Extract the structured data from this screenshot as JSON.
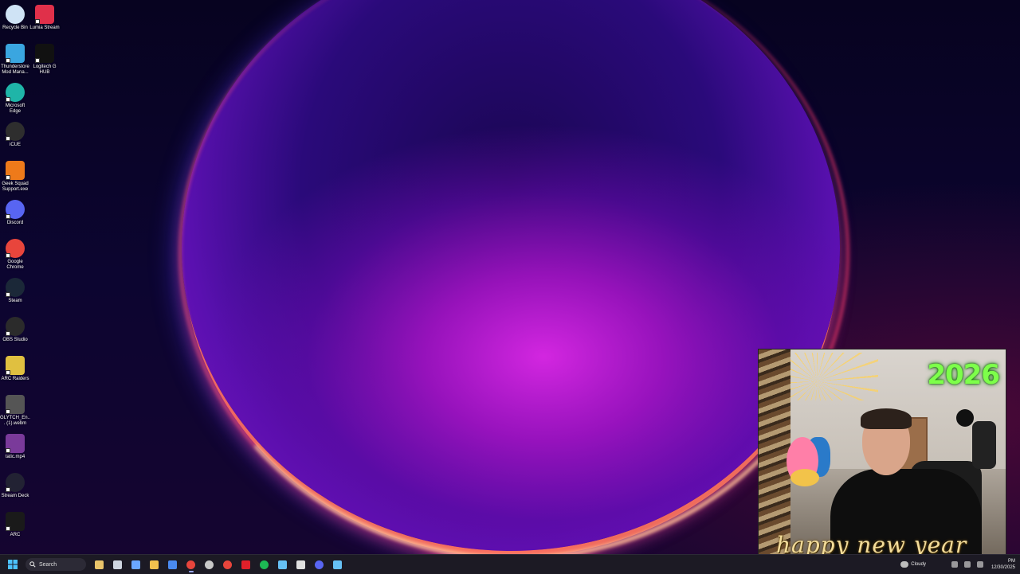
{
  "desktop": {
    "icons": [
      {
        "label": "Recycle Bin",
        "icon": "recycle-bin-icon",
        "color": "#cfe3f5"
      },
      {
        "label": "Lumia Stream",
        "icon": "lumia-stream-icon",
        "color": "#e0304a"
      },
      {
        "label": "Thunderstore Mod Mana...",
        "icon": "thunderstore-icon",
        "color": "#3aa6e0"
      },
      {
        "label": "Logitech G HUB",
        "icon": "logitech-g-icon",
        "color": "#111111"
      },
      {
        "label": "Microsoft Edge",
        "icon": "edge-icon",
        "color": "#1fb5a8"
      },
      {
        "label": "iCUE",
        "icon": "icue-icon",
        "color": "#2e2e2e"
      },
      {
        "label": "Geek Squad Support.exe",
        "icon": "geek-squad-icon",
        "color": "#ee7a1a"
      },
      {
        "label": "Discord",
        "icon": "discord-icon",
        "color": "#5865f2"
      },
      {
        "label": "Google Chrome",
        "icon": "chrome-icon",
        "color": "#e8453c"
      },
      {
        "label": "Steam",
        "icon": "steam-icon",
        "color": "#1b2838"
      },
      {
        "label": "OBS Studio",
        "icon": "obs-icon",
        "color": "#2b2b2b"
      },
      {
        "label": "ARC Raiders",
        "icon": "arc-raiders-icon",
        "color": "#e0c040"
      },
      {
        "label": "GLYTCH_En... (1).webm",
        "icon": "video-file-icon",
        "color": "#555555"
      },
      {
        "label": "tatic.mp4",
        "icon": "video-file-icon",
        "color": "#7a3a9a"
      },
      {
        "label": "Stream Deck",
        "icon": "stream-deck-icon",
        "color": "#222233"
      },
      {
        "label": "ARC",
        "icon": "arc-icon",
        "color": "#1a1a1a"
      }
    ]
  },
  "webcam": {
    "year_text": "2026",
    "overlay_text": "happy new year"
  },
  "taskbar": {
    "search_label": "Search",
    "apps": [
      {
        "icon": "file-explorer-widget-icon",
        "color": "#e9c46a"
      },
      {
        "icon": "task-view-icon",
        "color": "#cfd6e0"
      },
      {
        "icon": "copilot-icon",
        "color": "#6aa6ff"
      },
      {
        "icon": "file-explorer-icon",
        "color": "#f2c14e"
      },
      {
        "icon": "store-icon",
        "color": "#4a8af0"
      },
      {
        "icon": "chrome-icon",
        "color": "#e8453c",
        "active": true
      },
      {
        "icon": "obs-icon",
        "color": "#c8c8c8"
      },
      {
        "icon": "chrome-profile-icon",
        "color": "#e8453c"
      },
      {
        "icon": "adobe-icon",
        "color": "#e0202a"
      },
      {
        "icon": "spotify-icon",
        "color": "#1db954"
      },
      {
        "icon": "steam-icon",
        "color": "#66c0f4"
      },
      {
        "icon": "logitech-g-icon",
        "color": "#e0e0e0"
      },
      {
        "icon": "discord-icon",
        "color": "#5865f2"
      },
      {
        "icon": "steam-alt-icon",
        "color": "#66c0f4"
      }
    ],
    "weather_label": "Cloudy",
    "time": "PM",
    "date": "12/30/2025"
  }
}
